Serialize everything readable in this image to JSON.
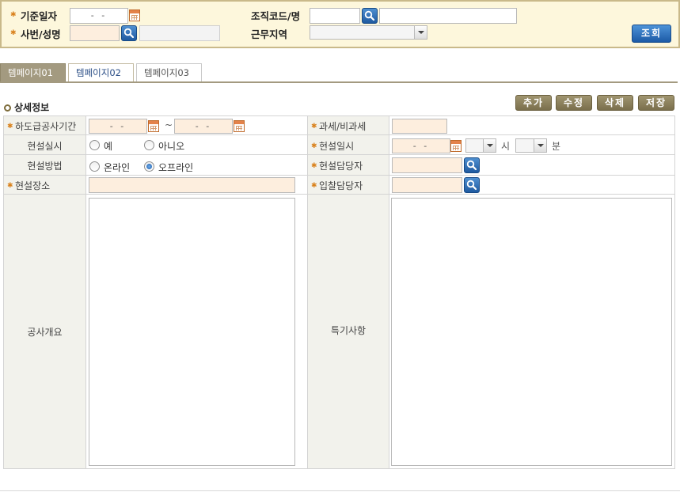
{
  "search": {
    "base_date_label": "기준일자",
    "base_date_value": "- -",
    "org_code_label": "조직코드/명",
    "emp_label": "사번/성명",
    "region_label": "근무지역",
    "search_button": "조회"
  },
  "tabs": [
    {
      "label": "템페이지01"
    },
    {
      "label": "템페이지02"
    },
    {
      "label": "템페이지03"
    }
  ],
  "section": {
    "title": "상세정보"
  },
  "actions": {
    "add": "추가",
    "edit": "수정",
    "delete": "삭제",
    "save": "저장"
  },
  "form": {
    "subcontract_period_label": "하도급공사기간",
    "period_start": "- -",
    "period_sep": "~",
    "period_end": "- -",
    "tax_label": "과세/비과세",
    "site_briefing_label": "현설실시",
    "opt_yes": "예",
    "opt_no": "아니오",
    "site_date_label": "현설일시",
    "site_date_value": "- -",
    "hour_unit": "시",
    "minute_unit": "분",
    "method_label": "현설방법",
    "opt_online": "온라인",
    "opt_offline": "오프라인",
    "site_manager_label": "현설담당자",
    "place_label": "현설장소",
    "bid_manager_label": "입찰담당자",
    "overview_label": "공사개요",
    "remarks_label": "특기사항"
  },
  "state": {
    "site_briefing": "none",
    "method": "오프라인"
  },
  "colors": {
    "panel_bg": "#fdf7dc",
    "required_bg": "#fdeede",
    "tab_active": "#a39a80",
    "primary_btn": "#1c5aa6",
    "action_btn": "#7a6f4c"
  }
}
